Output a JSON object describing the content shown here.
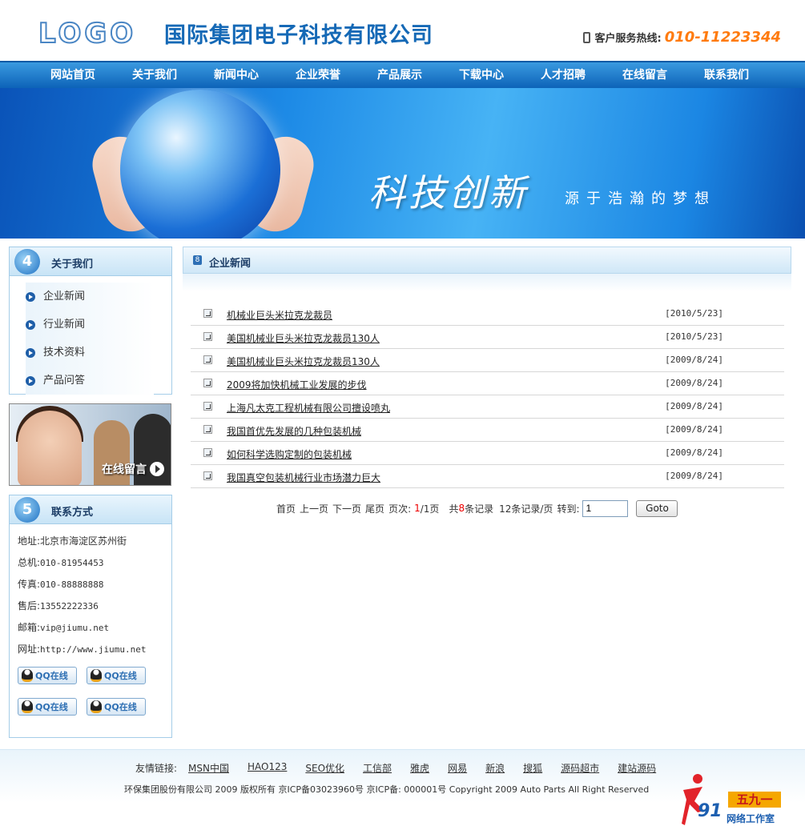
{
  "header": {
    "logo": "LOGO",
    "company": "国际集团电子科技有限公司",
    "hotline_label": "客户服务热线:",
    "hotline_number": "010-11223344"
  },
  "nav": [
    "网站首页",
    "关于我们",
    "新闻中心",
    "企业荣誉",
    "产品展示",
    "下载中心",
    "人才招聘",
    "在线留言",
    "联系我们"
  ],
  "banner": {
    "slogan": "科技创新",
    "sub_slogan": "源于浩瀚的梦想"
  },
  "about": {
    "title": "关于我们",
    "items": [
      "企业新闻",
      "行业新闻",
      "技术资料",
      "产品问答"
    ]
  },
  "service": {
    "label": "在线留言"
  },
  "contact": {
    "title": "联系方式",
    "rows": [
      {
        "label": "地址:",
        "value": "北京市海淀区苏州街"
      },
      {
        "label": "总机:",
        "value": "010-81954453"
      },
      {
        "label": "传真:",
        "value": "010-88888888"
      },
      {
        "label": "售后:",
        "value": "13552222336"
      },
      {
        "label": "邮箱:",
        "value": "vip@jiumu.net"
      },
      {
        "label": "网址:",
        "value": "http://www.jiumu.net"
      }
    ],
    "qq_label": "QQ在线"
  },
  "main": {
    "title": "企业新闻",
    "news": [
      {
        "title": "机械业巨头米拉克龙裁员",
        "date": "[2010/5/23]"
      },
      {
        "title": "美国机械业巨头米拉克龙裁员130人",
        "date": "[2010/5/23]"
      },
      {
        "title": "美国机械业巨头米拉克龙裁员130人",
        "date": "[2009/8/24]"
      },
      {
        "title": "2009将加快机械工业发展的步伐",
        "date": "[2009/8/24]"
      },
      {
        "title": "上海凡太克工程机械有限公司擅设喷丸",
        "date": "[2009/8/24]"
      },
      {
        "title": "我国首优先发展的几种包装机械",
        "date": "[2009/8/24]"
      },
      {
        "title": "如何科学选购定制的包装机械",
        "date": "[2009/8/24]"
      },
      {
        "title": "我国真空包装机械行业市场潜力巨大",
        "date": "[2009/8/24]"
      }
    ],
    "pager": {
      "first": "首页",
      "prev": "上一页",
      "next": "下一页",
      "last": "尾页",
      "page_label": "页次:",
      "page_current": "1",
      "page_total": "/1页",
      "total_prefix": "共",
      "total_count": "8",
      "total_suffix": "条记录",
      "per_page": "12条记录/页",
      "goto_label": "转到:",
      "goto_value": "1",
      "goto_button": "Goto"
    }
  },
  "footer": {
    "links_label": "友情链接:",
    "links": [
      "MSN中国",
      "HAO123",
      "SEO优化",
      "工信部",
      "雅虎",
      "网易",
      "新浪",
      "搜狐",
      "源码超市",
      "建站源码"
    ],
    "copyright": "环保集团股份有限公司 2009 版权所有 京ICP备03023960号 京ICP备: 000001号 Copyright 2009 Auto Parts All Right Reserved",
    "watermark_number": "91",
    "watermark_box": "五九一",
    "watermark_sub": "网络工作室"
  },
  "colors": {
    "nav_bg": "#0d63b8",
    "company_text": "#1569b6",
    "hotline_number": "#ff7b0f",
    "pager_highlight": "#ee0000"
  }
}
